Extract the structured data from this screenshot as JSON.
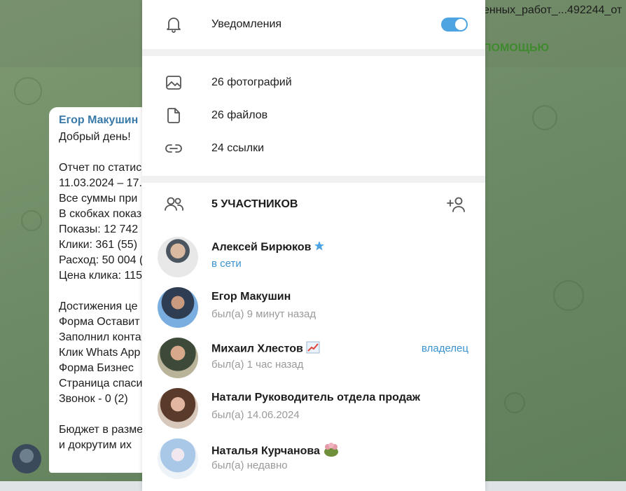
{
  "chat": {
    "file_name": "енных_работ_...492244_от",
    "help_label": "ПОМОЩЬЮ",
    "message": {
      "author": "Егор Макушин",
      "lines": [
        "Добрый день!",
        "",
        "Отчет по статис",
        "11.03.2024 – 17.",
        "Все суммы при",
        "В скобках показ",
        "Показы: 12 742",
        "Клики: 361 (55)",
        "Расход: 50 004 (",
        "Цена клика: 115",
        "",
        "Достижения це",
        "Форма Оставит",
        "Заполнил конта",
        "Клик Whats App",
        "Форма Бизнес",
        "Страница спаси",
        "Звонок - 0 (2)",
        "",
        "Бюджет в разме",
        "и докрутим их"
      ]
    }
  },
  "panel": {
    "notifications": {
      "label": "Уведомления",
      "enabled": true
    },
    "media": [
      {
        "icon": "photo-icon",
        "label": "26 фотографий"
      },
      {
        "icon": "file-icon",
        "label": "26 файлов"
      },
      {
        "icon": "link-icon",
        "label": "24 ссылки"
      }
    ],
    "members_title": "5 УЧАСТНИКОВ",
    "members": [
      {
        "name": "Алексей Бирюков",
        "status": "в сети",
        "online": true,
        "badge": "star",
        "role": ""
      },
      {
        "name": "Егор Макушин",
        "status": "был(а) 9 минут назад",
        "online": false,
        "badge": "",
        "role": ""
      },
      {
        "name": "Михаил Хлестов",
        "status": "был(а) 1 час назад",
        "online": false,
        "badge": "chart",
        "role": "владелец"
      },
      {
        "name": "Натали Руководитель отдела продаж",
        "status": "был(а) 14.06.2024",
        "online": false,
        "badge": "",
        "role": ""
      },
      {
        "name": "Наталья Курчанова",
        "status": "был(а) недавно",
        "online": false,
        "badge": "frog",
        "role": ""
      }
    ]
  },
  "colors": {
    "accent": "#4ea4e0",
    "link": "#3a93d0",
    "muted": "#9a9a9a"
  }
}
